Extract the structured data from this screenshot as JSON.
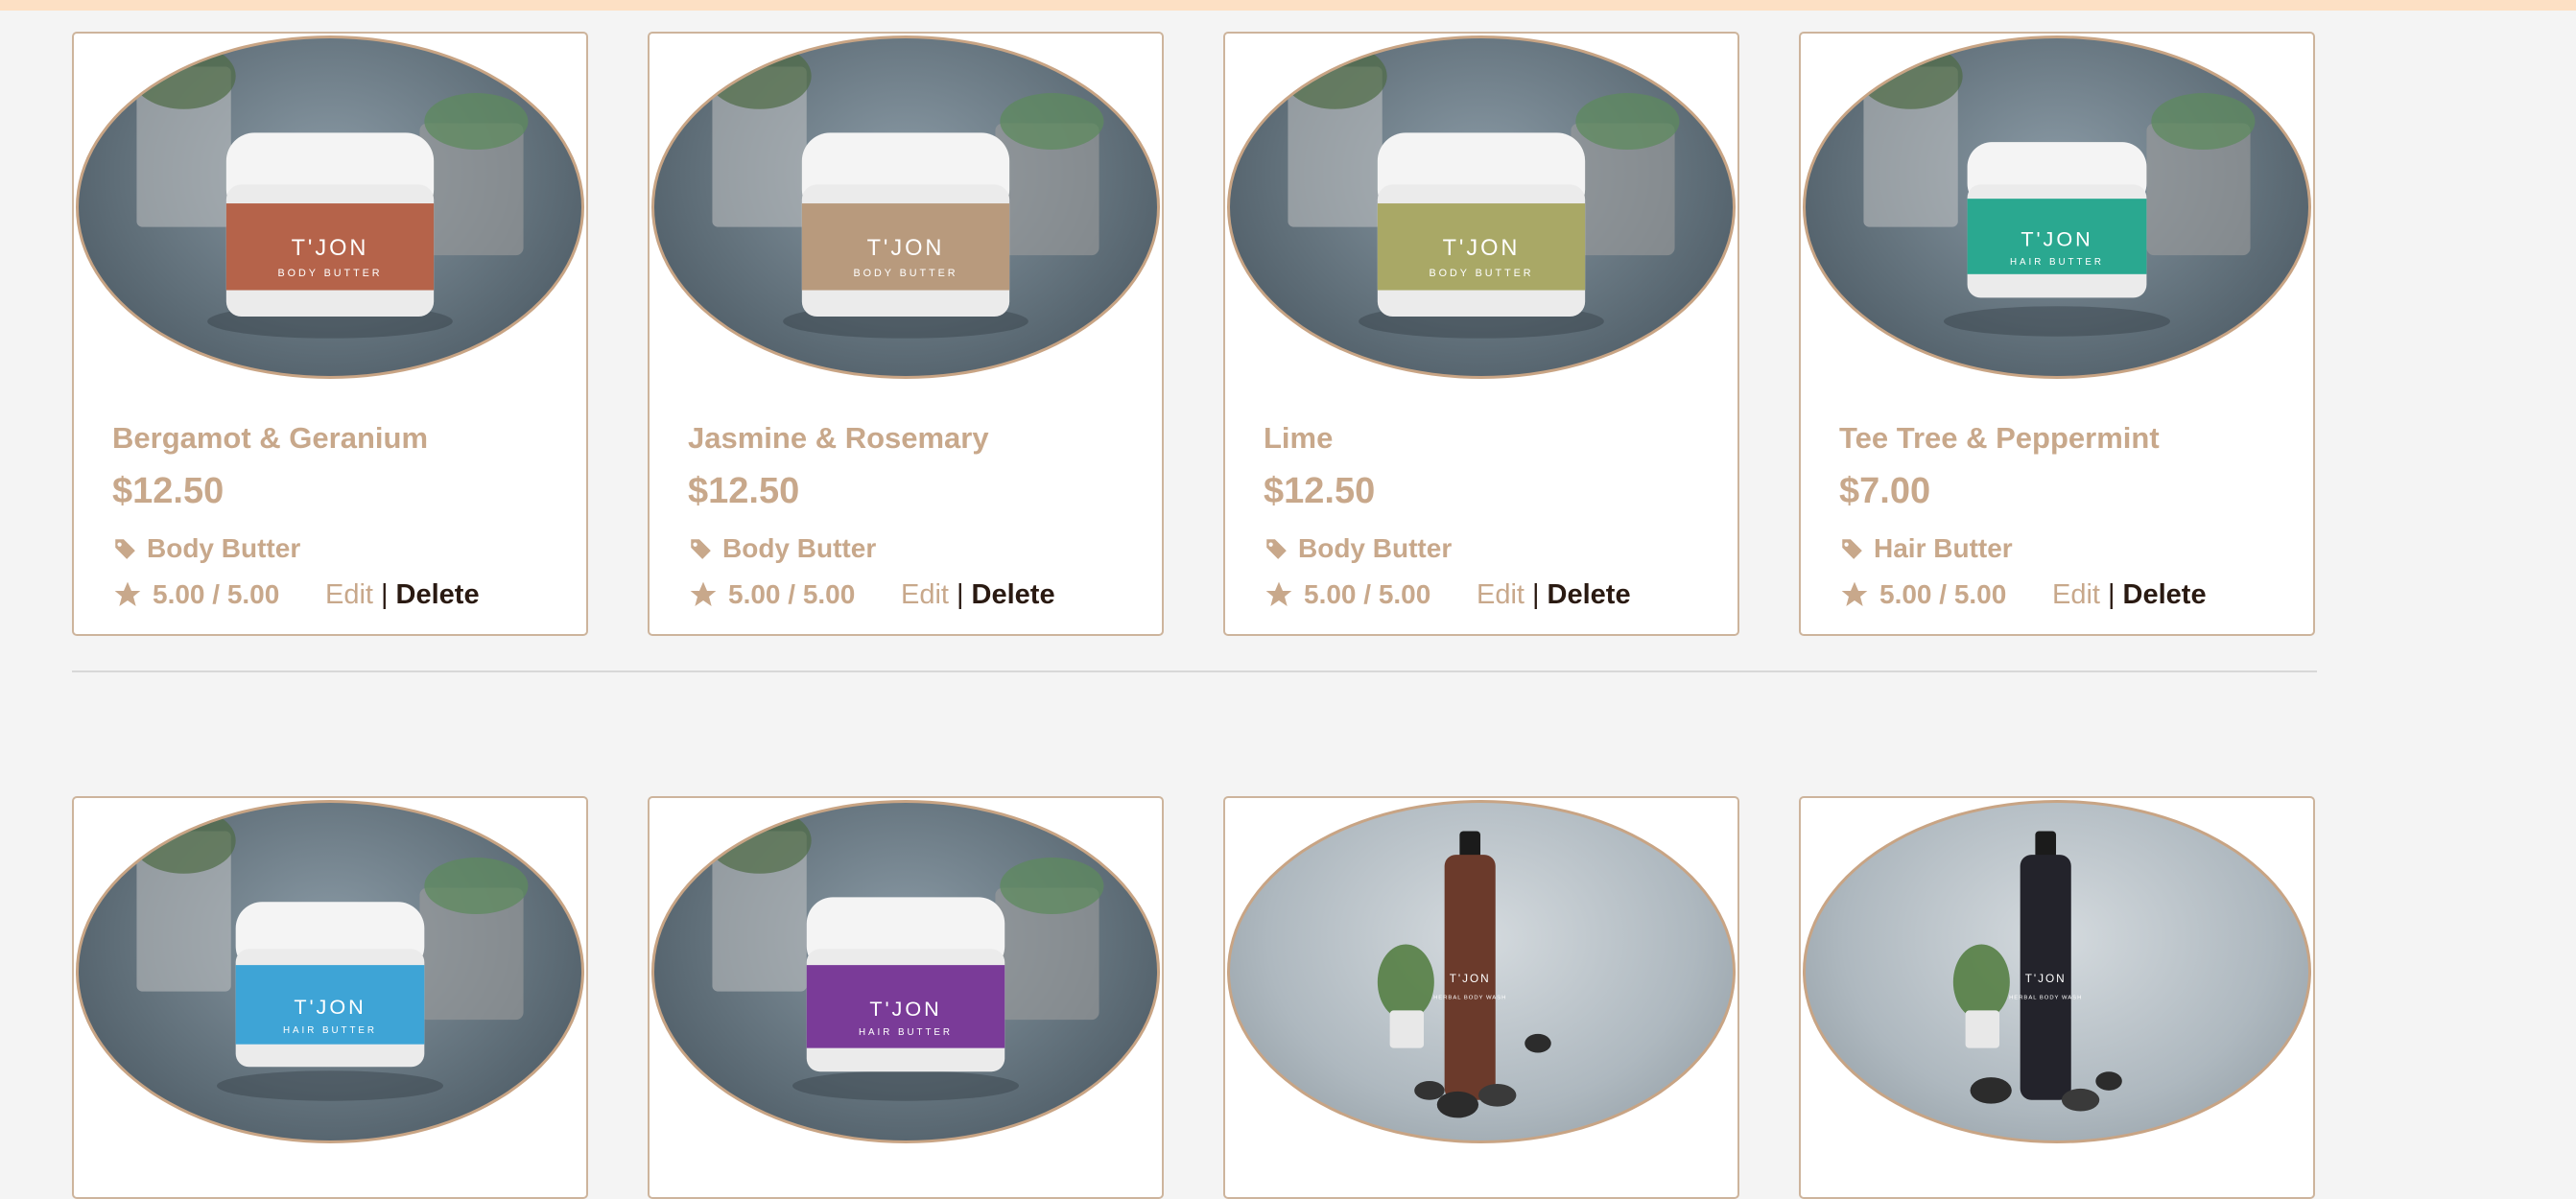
{
  "products_row1": [
    {
      "name": "Bergamot & Geranium",
      "price": "$12.50",
      "category": "Body Butter",
      "rating": "5.00 / 5.00",
      "label_color": "#b5634a",
      "brand": "T'JON",
      "label_text": "BODY BUTTER"
    },
    {
      "name": "Jasmine & Rosemary",
      "price": "$12.50",
      "category": "Body Butter",
      "rating": "5.00 / 5.00",
      "label_color": "#b89a7d",
      "brand": "T'JON",
      "label_text": "BODY BUTTER"
    },
    {
      "name": "Lime",
      "price": "$12.50",
      "category": "Body Butter",
      "rating": "5.00 / 5.00",
      "label_color": "#a9a866",
      "brand": "T'JON",
      "label_text": "BODY BUTTER"
    },
    {
      "name": "Tee Tree & Peppermint",
      "price": "$7.00",
      "category": "Hair Butter",
      "rating": "5.00 / 5.00",
      "label_color": "#2aa890",
      "brand": "T'JON",
      "label_text": "HAIR BUTTER"
    }
  ],
  "products_row2": [
    {
      "label_color": "#3ea4d6",
      "brand": "T'JON",
      "label_text": "HAIR BUTTER"
    },
    {
      "label_color": "#7a3b98",
      "brand": "T'JON",
      "label_text": "HAIR BUTTER"
    },
    {
      "label_color": "#6b3a2b",
      "brand": "T'JON",
      "label_text": "HERBAL BODY WASH"
    },
    {
      "label_color": "#23232b",
      "brand": "T'JON",
      "label_text": "HERBAL BODY WASH"
    }
  ],
  "actions": {
    "edit": "Edit",
    "separator": "|",
    "delete": "Delete"
  },
  "colors": {
    "accent": "#c8a88b",
    "dark": "#2a1a12",
    "topbar": "#fde0c4",
    "background": "#f4f4f4"
  },
  "icons": {
    "category": "tag-icon",
    "rating": "star-icon"
  }
}
